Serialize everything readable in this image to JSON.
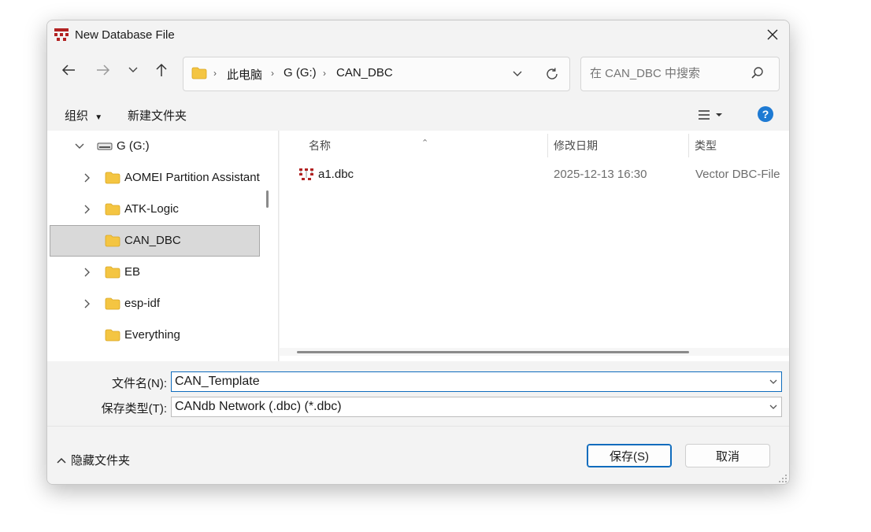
{
  "window": {
    "title": "New Database File"
  },
  "nav": {
    "breadcrumbs": [
      "此电脑",
      "G (G:)",
      "CAN_DBC"
    ],
    "search_placeholder": "在 CAN_DBC 中搜索"
  },
  "commands": {
    "organize": "组织",
    "new_folder": "新建文件夹",
    "help": "?"
  },
  "tree": [
    {
      "label": "G (G:)",
      "icon": "drive-icon",
      "expander": "chevron-down"
    },
    {
      "label": "AOMEI Partition Assistant",
      "icon": "folder-icon",
      "expander": "chevron-right"
    },
    {
      "label": "ATK-Logic",
      "icon": "folder-icon",
      "expander": "chevron-right"
    },
    {
      "label": "CAN_DBC",
      "icon": "folder-icon",
      "expander": "none",
      "selected": true
    },
    {
      "label": "EB",
      "icon": "folder-icon",
      "expander": "chevron-right"
    },
    {
      "label": "esp-idf",
      "icon": "folder-icon",
      "expander": "chevron-right"
    },
    {
      "label": "Everything",
      "icon": "folder-icon",
      "expander": "none"
    }
  ],
  "file_list": {
    "columns": [
      "名称",
      "修改日期",
      "类型"
    ],
    "rows": [
      {
        "name": "a1.dbc",
        "modified": "2025-12-13 16:30",
        "type": "Vector DBC-File"
      }
    ]
  },
  "form": {
    "filename_label": "文件名(N):",
    "filename_value": "CAN_Template",
    "filetype_label": "保存类型(T):",
    "filetype_value": "CANdb Network (.dbc) (*.dbc)"
  },
  "footer": {
    "hide_folders": "隐藏文件夹",
    "save": "保存(S)",
    "cancel": "取消"
  },
  "colors": {
    "accent": "#0f6cbd",
    "help": "#1e7ad3",
    "folder": "#f4c542",
    "dbc_icon": "#b22222"
  }
}
